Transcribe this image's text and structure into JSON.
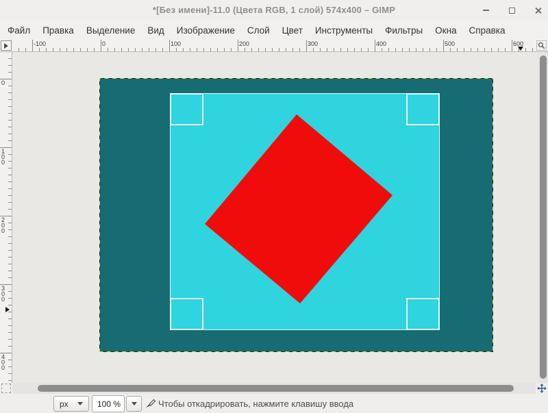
{
  "titlebar": {
    "title": "*[Без имени]-11.0 (Цвета RGB, 1 слой) 574x400 – GIMP"
  },
  "menubar": {
    "items": [
      "Файл",
      "Правка",
      "Выделение",
      "Вид",
      "Изображение",
      "Слой",
      "Цвет",
      "Инструменты",
      "Фильтры",
      "Окна",
      "Справка"
    ]
  },
  "rulers": {
    "horizontal_labels": [
      "-100",
      "0",
      "100",
      "200",
      "300",
      "400",
      "500",
      "600"
    ],
    "vertical_labels": [
      "0",
      "100",
      "200",
      "300",
      "400"
    ]
  },
  "canvas": {
    "tool": "crop",
    "colors": {
      "image_background": "#176b72",
      "crop_area_fill": "#2fd4de",
      "shape_fill": "#f10c0c",
      "layer_boundary_dash": "#c8d84b",
      "surround": "#e9e8e5"
    }
  },
  "statusbar": {
    "unit_value": "px",
    "zoom_value": "100 %",
    "message": "Чтобы откадрировать, нажмите клавишу ввода"
  }
}
